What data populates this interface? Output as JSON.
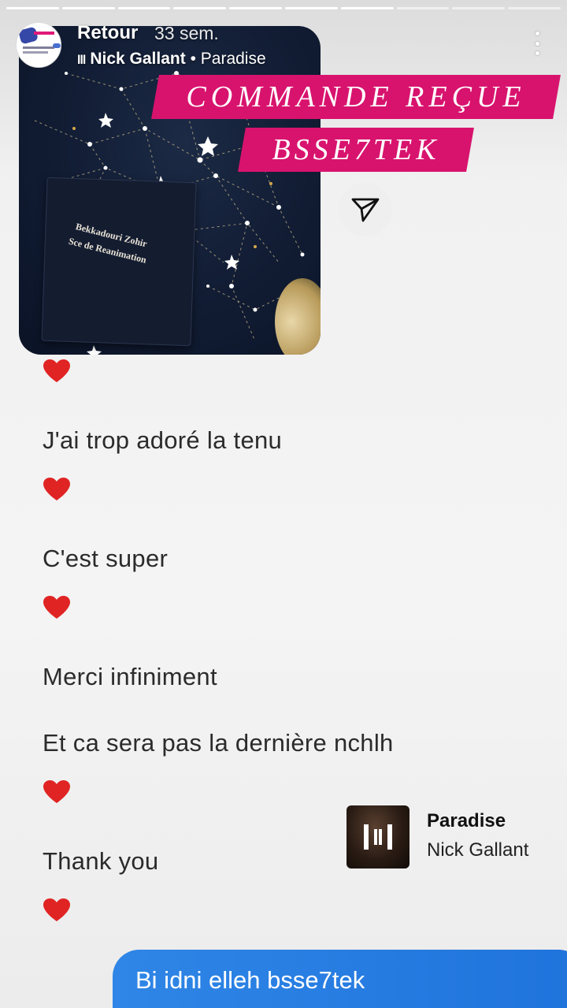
{
  "story": {
    "segments_total": 10,
    "segments_done": 7,
    "header": {
      "username": "Retour",
      "time_ago": "33 sem.",
      "music_bars": "lll",
      "music_artist": "Nick Gallant",
      "music_sep": " • ",
      "music_title": "Paradise"
    },
    "photo": {
      "embroidery_line1": "Bekkadouri Zohir",
      "embroidery_line2": "Sce de Reanimation"
    },
    "banners": [
      "COMMANDE REÇUE",
      "BSSE7TEK"
    ],
    "messages": [
      "J'ai trop adoré la tenu",
      "C'est super",
      "Merci infiniment",
      "Et ca sera pas la dernière nchlh",
      "Thank you"
    ],
    "music_sticker": {
      "title": "Paradise",
      "artist": "Nick Gallant"
    },
    "reply": "Bi idni elleh bsse7tek",
    "colors": {
      "banner_pink": "#d8136e",
      "heart_red": "#e02424",
      "reply_blue": "#2f86e6"
    }
  }
}
